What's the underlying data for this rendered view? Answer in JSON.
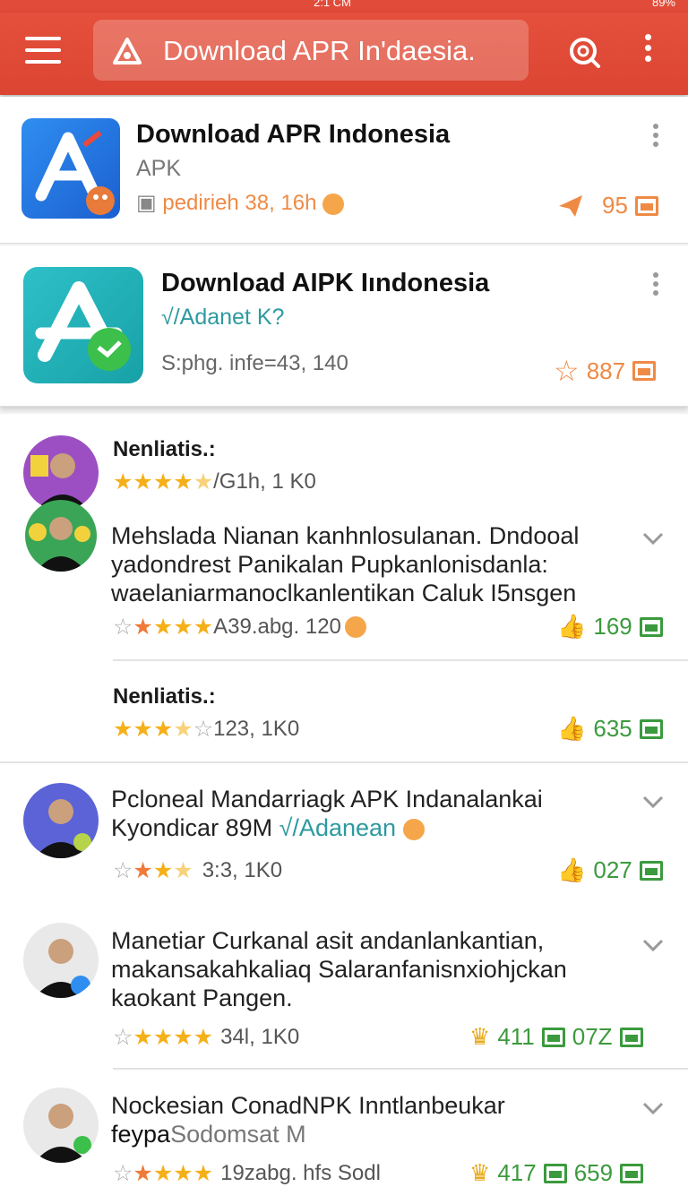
{
  "status": {
    "time": "2:1 CM",
    "battery": "89%"
  },
  "topbar": {
    "search_title": "Download APR In'daesia."
  },
  "apps": [
    {
      "title": "Download APR Indonesia",
      "subtitle": "APK",
      "meta": "pedirieh 38, 16h",
      "stat_value": "95",
      "accent": "#ef8a45"
    },
    {
      "title": "Download AIPK Iındonesia",
      "subtitle": "√/Adanet K?",
      "meta": "S:phg. infe=43, 140",
      "stat_value": "887",
      "accent": "#ef8a45"
    }
  ],
  "reviews": [
    {
      "name": "Nenliatis.:",
      "rating_text": "/G1h, 1 K0",
      "stars": [
        1,
        1,
        1,
        1,
        0.5
      ]
    },
    {
      "text": "Mehslada Nianan kanhnlosulanan. Dndooal yadondrest Panikalan Pupkanlonisdanla: waelaniarmanoclkanlentikan Caluk I5nsgen",
      "rating_text": "A39.abg. 120",
      "likes": "169"
    },
    {
      "name": "Nenliatis.:",
      "rating_text": "123, 1K0",
      "likes": "635"
    },
    {
      "text_main": "Pcloneal Mandarriagk APK Indanalankai Kyondicar 89M",
      "text_link": "√/Adanean",
      "rating_text": "3:3, 1K0",
      "likes": "027"
    },
    {
      "text": "Manetiar Curkanal asit andanlankantian, makansakahkaliaq Salaranfanisnxiohjckan kaokant Pangen.",
      "rating_text": "34l, 1K0",
      "stat_a": "411",
      "stat_b": "07Z"
    },
    {
      "text_main": "Nockesian ConadNPK Inntlanbeukar",
      "text_bold": "feypa",
      "text_rest": "Sodomsat M",
      "rating_text": "19zabg. hfs Sodl",
      "stat_a": "417",
      "stat_b": "659"
    }
  ],
  "colors": {
    "brand": "#e14b39",
    "green": "#3b9a3d",
    "orange": "#ef8a45",
    "star": "#f5b019"
  }
}
